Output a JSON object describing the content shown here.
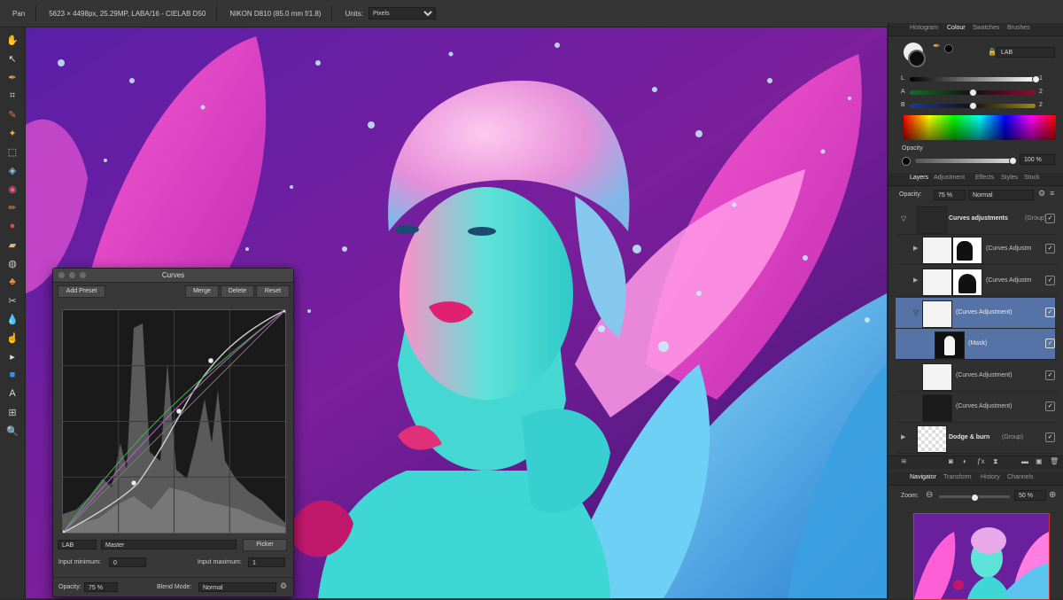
{
  "toolbar": {
    "tool": "Pan",
    "doc_info": "5623 × 4498px, 25.29MP, LABA/16 - CIELAB D50",
    "camera": "NIKON D810 (85.0 mm f/1.8)",
    "units_label": "Units:",
    "units_value": "Pixels"
  },
  "tools": [
    "hand-tool-icon",
    "move-tool-icon",
    "color-picker-icon",
    "crop-tool-icon",
    "paint-brush-icon",
    "flood-select-icon",
    "marquee-icon",
    "fill-icon",
    "color-wheel-icon",
    "brush-icon",
    "red-eye-icon",
    "healing-icon",
    "zoom-blur-icon",
    "clone-icon",
    "dodge-icon",
    "blur-icon",
    "smudge-icon",
    "node-tool-icon",
    "rectangle-icon",
    "text-tool-icon",
    "mesh-icon",
    "zoom-tool-icon"
  ],
  "text_tool_glyph": "A",
  "curves": {
    "title": "Curves",
    "add_preset": "Add Preset",
    "merge": "Merge",
    "delete": "Delete",
    "reset": "Reset",
    "colour_space": "LAB",
    "channel": "Master",
    "picker": "Picker",
    "input_min_label": "Input minimum:",
    "input_min_value": "0",
    "input_max_label": "Input maximum:",
    "input_max_value": "1",
    "opacity_label": "Opacity:",
    "opacity_value": "75 %",
    "blend_label": "Blend Mode:",
    "blend_value": "Normal"
  },
  "top_tabs": [
    "Histogram",
    "Colour",
    "Swatches",
    "Brushes"
  ],
  "colour": {
    "model": "LAB",
    "channels": [
      {
        "name": "L",
        "value": "1",
        "level": 1.0
      },
      {
        "name": "A",
        "value": "2",
        "level": 0.5
      },
      {
        "name": "B",
        "value": "2",
        "level": 0.5
      }
    ],
    "opacity_label": "Opacity",
    "opacity_value": "100 %"
  },
  "layer_tabs": [
    "Layers",
    "Adjustment",
    "Effects",
    "Styles",
    "Stock"
  ],
  "layers_panel": {
    "opacity_label": "Opacity:",
    "opacity_value": "75 %",
    "blend_value": "Normal",
    "items": [
      {
        "name": "Curves adjustments",
        "suffix": "(Group)"
      },
      {
        "name": "(Curves Adjustm"
      },
      {
        "name": "(Curves Adjustm"
      },
      {
        "name": "(Curves Adjustment)"
      },
      {
        "name": "(Mask)"
      },
      {
        "name": "(Curves Adjustment)"
      },
      {
        "name": "(Curves Adjustment)"
      },
      {
        "name": "Dodge & burn",
        "suffix": "(Group)"
      }
    ]
  },
  "nav_tabs": [
    "Navigator",
    "Transform",
    "History",
    "Channels"
  ],
  "navigator": {
    "zoom_label": "Zoom:",
    "zoom_value": "50 %",
    "zoom_level": 0.5
  }
}
